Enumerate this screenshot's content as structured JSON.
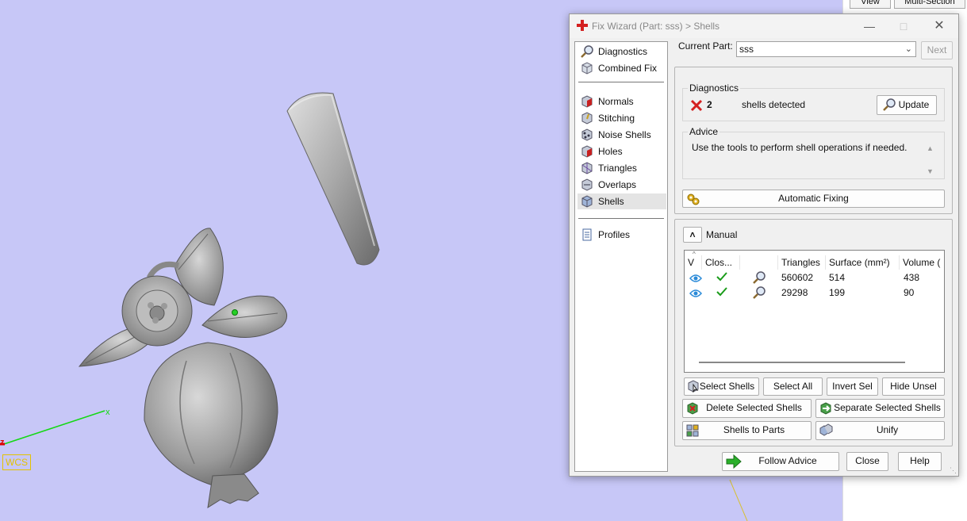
{
  "viewport": {
    "wcs_label": "WCS",
    "axis_x": "x",
    "axis_z": "z"
  },
  "side_panel": {
    "tab_view": "View",
    "tab_multi_section": "Multi-Section"
  },
  "dialog": {
    "title": "Fix Wizard (Part: sss) > Shells",
    "nav": {
      "top": [
        "Diagnostics",
        "Combined Fix"
      ],
      "tools": [
        "Normals",
        "Stitching",
        "Noise Shells",
        "Holes",
        "Triangles",
        "Overlaps",
        "Shells"
      ],
      "bottom": [
        "Profiles"
      ],
      "selected": "Shells"
    },
    "current_part_label": "Current Part:",
    "current_part_value": "sss",
    "next_label": "Next",
    "diagnostics": {
      "title": "Diagnostics",
      "count": "2",
      "status_text": "shells detected",
      "update_label": "Update"
    },
    "advice": {
      "title": "Advice",
      "text": "Use the tools to perform shell operations if needed."
    },
    "automatic_fixing_label": "Automatic Fixing",
    "manual": {
      "label": "Manual",
      "columns": [
        "V",
        "Clos...",
        "",
        "Triangles",
        "Surface (mm²)",
        "Volume ("
      ],
      "rows": [
        {
          "visible": true,
          "closed": true,
          "triangles": "560602",
          "surface": "514",
          "volume": "438"
        },
        {
          "visible": true,
          "closed": true,
          "triangles": "29298",
          "surface": "199",
          "volume": "90"
        }
      ]
    },
    "buttons": {
      "select_shells": "Select Shells",
      "select_all": "Select All",
      "invert_sel": "Invert Sel",
      "hide_unsel": "Hide Unsel",
      "delete_selected_shells": "Delete Selected Shells",
      "separate_selected_shells": "Separate Selected Shells",
      "shells_to_parts": "Shells to Parts",
      "unify": "Unify",
      "follow_advice": "Follow Advice",
      "close": "Close",
      "help": "Help"
    }
  },
  "colors": {
    "viewport_bg": "#c7c7f7",
    "axis_x": "#14d814",
    "axis_z": "#dd0000",
    "wcs": "#e3c200",
    "error_red": "#d42020",
    "check_green": "#1a9c1a",
    "eye_blue": "#2a8ad8"
  }
}
